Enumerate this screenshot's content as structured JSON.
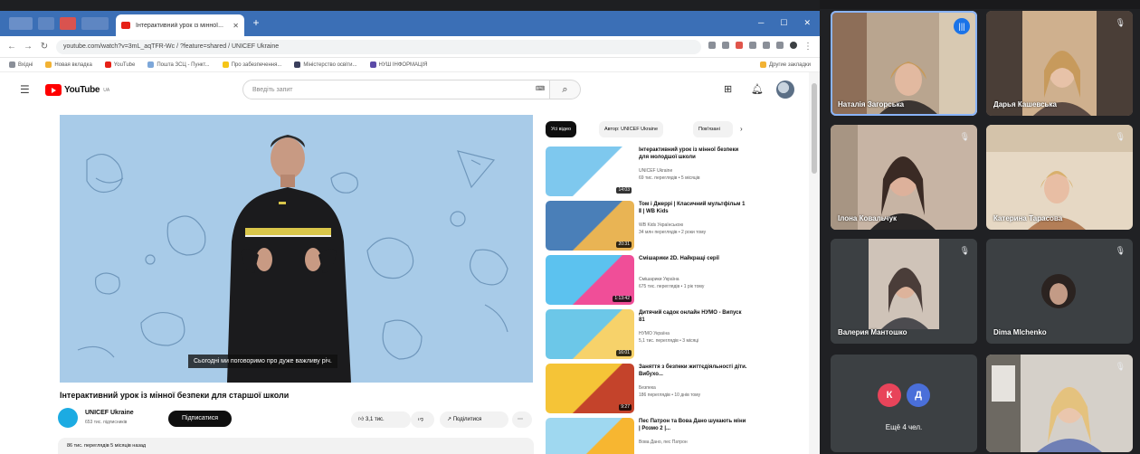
{
  "browser": {
    "tab_title": "Інтерактивний урок із мінної...",
    "url": "youtube.com/watch?v=3mL_aqTFR-Wc / ?feature=shared / UNICEF Ukraine",
    "bookmarks": [
      "Вхідні",
      "Новая вкладка",
      "YouTube",
      "Пошта ЗСЦ - Пункт...",
      "Про забезпечення...",
      "Міністерство освіти...",
      "НУШ ІНФОРМАЦІЯ"
    ],
    "bookmark_other": "Другие закладки"
  },
  "youtube": {
    "logo": "YouTube",
    "logo_sup": "UA",
    "search_placeholder": "Введіть запит",
    "player": {
      "subtitle": "Сьогодні ми поговоримо про дуже важливу річ."
    },
    "video": {
      "title": "Інтерактивний урок із мінної безпеки для старшої школи",
      "channel": "UNICEF Ukraine",
      "subscribers": "653 тис. підписників",
      "subscribe_label": "Підписатися",
      "likes": "3,1 тис.",
      "share_label": "Поділитися",
      "views_line": "86 тис. переглядів  5 місяців назад"
    },
    "chips": [
      "Усі відео",
      "Автор: UNICEF Ukraine",
      "Пов'язані"
    ],
    "recommendations": [
      {
        "title": "Інтерактивний урок із мінної безпеки для молодшої школи",
        "channel": "UNICEF Ukraine",
        "meta": "69 тис. переглядів • 5 місяців",
        "duration": "14:03",
        "color1": "#7ec8ee",
        "color2": "#ffffff"
      },
      {
        "title": "Том і Джеррі | Класичний мультфільм 1 Ⅱ | WB Kids",
        "channel": "WB Kids Українською",
        "meta": "34 млн переглядів • 2 роки тому",
        "duration": "20:31",
        "color1": "#4a7fb8",
        "color2": "#e9b454"
      },
      {
        "title": "Смішарики 2D. Найкращі серії",
        "channel": "Смішарики Україна",
        "meta": "675 тис. переглядів • 1 рік тому",
        "duration": "1:13:42",
        "color1": "#5cc2ef",
        "color2": "#f04e98"
      },
      {
        "title": "Дитячий садок онлайн НУМО - Випуск 81",
        "channel": "НУМО Україна",
        "meta": "5,1 тис. переглядів • 3 місяці",
        "duration": "16:01",
        "color1": "#6cc7e8",
        "color2": "#f7d26a"
      },
      {
        "title": "Заняття з безпеки життєдіяльності діти. Вибухо...",
        "channel": "Безпека",
        "meta": "186 переглядів • 10 днів тому",
        "duration": "9:27",
        "color1": "#f5c437",
        "color2": "#c4432b"
      },
      {
        "title": "Пес Патрон та Вова Дано шукають міни | Розмо 2 |...",
        "channel": "Вова Дано, пес Патрон",
        "meta": "",
        "duration": "",
        "color1": "#9fd8f0",
        "color2": "#f7b631"
      }
    ]
  },
  "meeting": {
    "participants": [
      {
        "name": "Наталія Загорська",
        "speaking": true
      },
      {
        "name": "Дарья Кашевська",
        "speaking": false
      },
      {
        "name": "Ілона Ковальчук",
        "speaking": false
      },
      {
        "name": "Катерина Тарасова",
        "speaking": false
      },
      {
        "name": "Валерия Мантошко",
        "speaking": false
      },
      {
        "name": "Dima Mlchenko",
        "speaking": false
      },
      {
        "name": "",
        "speaking": false
      }
    ],
    "others_label": "Ещё 4 чел.",
    "others_initials": [
      "К",
      "Д"
    ],
    "colors": {
      "initial_k": "#e8445a",
      "initial_d": "#4a6fd9",
      "bg": "#202124",
      "tile": "#3c4043"
    }
  },
  "colors": {
    "yt_red": "#ff0000",
    "tabbar": "#3b6fb6",
    "player_bg": "#a8cbe8"
  }
}
